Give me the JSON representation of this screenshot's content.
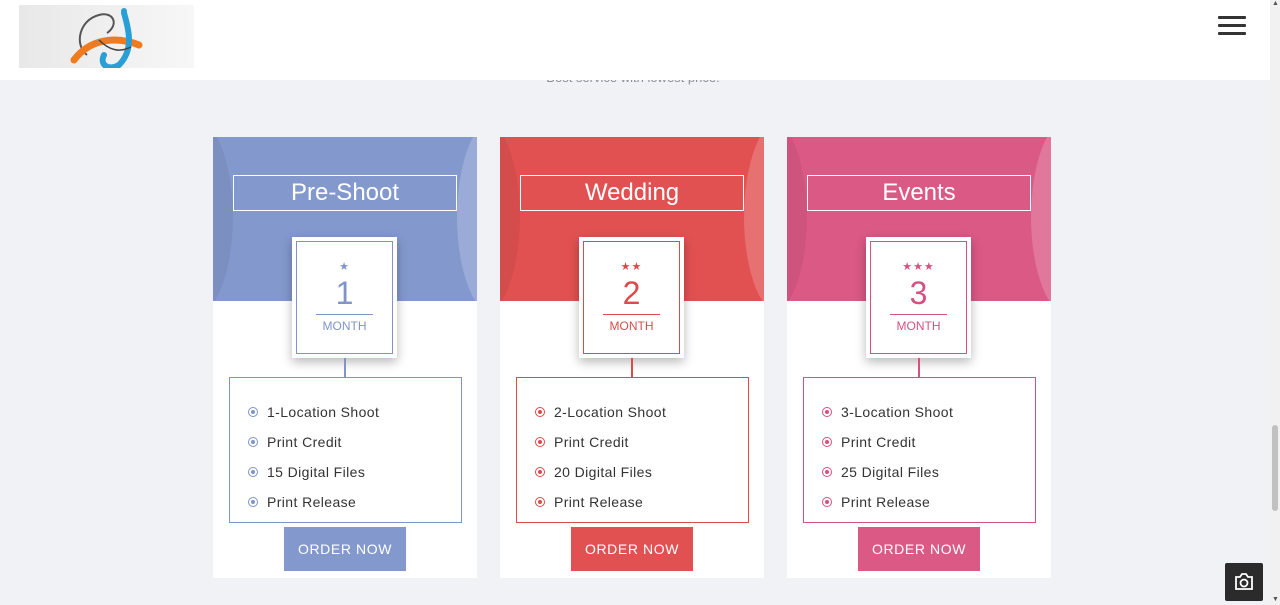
{
  "header": {
    "menu_icon": "hamburger-menu-icon"
  },
  "tagline": "Best service with lowest price!",
  "plans": [
    {
      "name": "Pre-Shoot",
      "stars": "★",
      "number": "1",
      "unit": "MONTH",
      "color": "#8399cd",
      "accent": "#7f94c9",
      "features": [
        "1-Location Shoot",
        "Print Credit",
        "15 Digital Files",
        "Print Release"
      ],
      "button": "ORDER NOW"
    },
    {
      "name": "Wedding",
      "stars": "★★",
      "number": "2",
      "unit": "MONTH",
      "color": "#e25151",
      "accent": "#dc4b4b",
      "features": [
        "2-Location Shoot",
        "Print Credit",
        "20 Digital Files",
        "Print Release"
      ],
      "button": "ORDER NOW"
    },
    {
      "name": "Events",
      "stars": "★★★",
      "number": "3",
      "unit": "MONTH",
      "color": "#db5985",
      "accent": "#d6527e",
      "features": [
        "3-Location Shoot",
        "Print Credit",
        "25 Digital Files",
        "Print Release"
      ],
      "button": "ORDER NOW"
    }
  ],
  "camera_icon": "camera-icon"
}
